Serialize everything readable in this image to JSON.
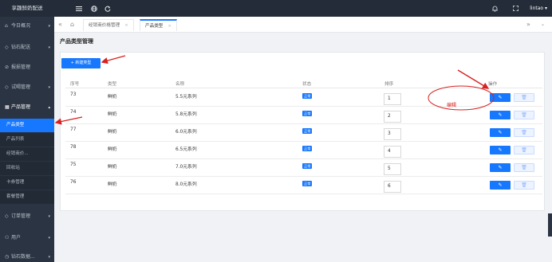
{
  "topbar": {
    "brand": "享趣鲜奶配送",
    "menu_icon": "hamburger-icon",
    "globe_icon": "globe-icon",
    "refresh_icon": "refresh-icon",
    "bell_icon": "bell-icon",
    "fullscreen_icon": "fullscreen-icon",
    "user": "lintao"
  },
  "sidebar": {
    "items": [
      {
        "label": "今日概况",
        "icon": "home-icon",
        "caret": "▾"
      },
      {
        "label": "钻石配送",
        "icon": "diamond-icon",
        "caret": "▾"
      },
      {
        "label": "报损管理",
        "icon": "report-icon",
        "caret": ""
      },
      {
        "label": "试喝管理",
        "icon": "cup-icon",
        "caret": "▾"
      },
      {
        "label": "产品管理",
        "icon": "product-icon",
        "caret": "▴"
      },
      {
        "label": "订单管理",
        "icon": "order-icon",
        "caret": "▾"
      },
      {
        "label": "用户",
        "icon": "user-icon",
        "caret": "▾"
      },
      {
        "label": "钻石数据...",
        "icon": "data-icon",
        "caret": "▾"
      }
    ],
    "sub_items": [
      "产品类型",
      "产品列表",
      "经销商价...",
      "回收站",
      "卡券管理",
      "套餐管理"
    ]
  },
  "tabs": {
    "items": [
      {
        "label": "经销商价格管理"
      },
      {
        "label": "产品类型"
      }
    ]
  },
  "page": {
    "title": "产品类型管理",
    "add_button": "+ 新建类型"
  },
  "table": {
    "headers": [
      "序号",
      "类型",
      "名称",
      "状态",
      "排序",
      "操作"
    ],
    "rows": [
      {
        "id": "73",
        "type": "鲜奶",
        "name": "5.5元系列",
        "status": "正常",
        "sort": "1"
      },
      {
        "id": "74",
        "type": "鲜奶",
        "name": "5.8元系列",
        "status": "正常",
        "sort": "2"
      },
      {
        "id": "77",
        "type": "鲜奶",
        "name": "6.0元系列",
        "status": "正常",
        "sort": "3"
      },
      {
        "id": "78",
        "type": "鲜奶",
        "name": "6.5元系列",
        "status": "正常",
        "sort": "4"
      },
      {
        "id": "75",
        "type": "鲜奶",
        "name": "7.0元系列",
        "status": "正常",
        "sort": "5"
      },
      {
        "id": "76",
        "type": "鲜奶",
        "name": "8.0元系列",
        "status": "正常",
        "sort": "6"
      }
    ]
  },
  "annotation": {
    "label": "编辑",
    "color": "#d92020"
  },
  "colors": {
    "accent": "#1677ff",
    "sidebar_bg": "#2b3442",
    "topbar_bg": "#232c38"
  }
}
